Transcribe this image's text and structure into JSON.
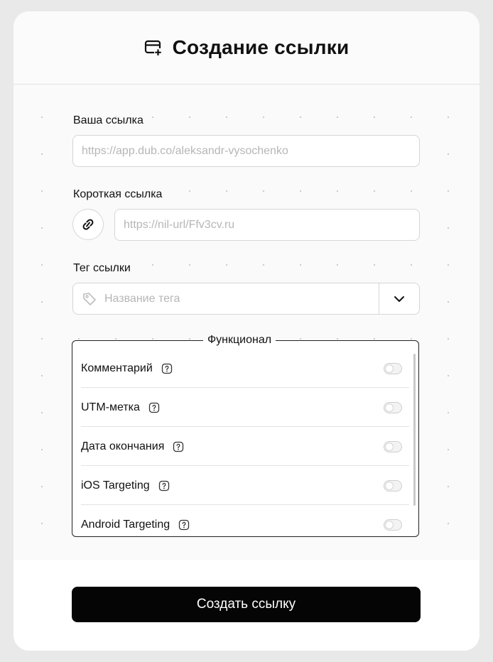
{
  "header": {
    "title": "Создание ссылки",
    "icon": "add-link-card-icon"
  },
  "form": {
    "your_link": {
      "label": "Ваша ссылка",
      "placeholder": "https://app.dub.co/aleksandr-vysochenko",
      "value": ""
    },
    "short_link": {
      "label": "Короткая ссылка",
      "placeholder": "https://nil-url/Ffv3cv.ru",
      "value": "",
      "icon": "link-icon"
    },
    "tag": {
      "label": "Тег ссылки",
      "placeholder": "Название тега",
      "value": "",
      "icon": "tag-icon",
      "dropdown_icon": "chevron-down-icon"
    }
  },
  "features": {
    "legend": "Функционал",
    "items": [
      {
        "label": "Комментарий",
        "enabled": false
      },
      {
        "label": "UTM-метка",
        "enabled": false
      },
      {
        "label": "Дата окончания",
        "enabled": false
      },
      {
        "label": "iOS Targeting",
        "enabled": false
      },
      {
        "label": "Android Targeting",
        "enabled": false
      }
    ]
  },
  "footer": {
    "submit_label": "Создать ссылку"
  },
  "colors": {
    "primary_button": "#050505",
    "background": "#e9e9e9",
    "card": "#ffffff"
  }
}
